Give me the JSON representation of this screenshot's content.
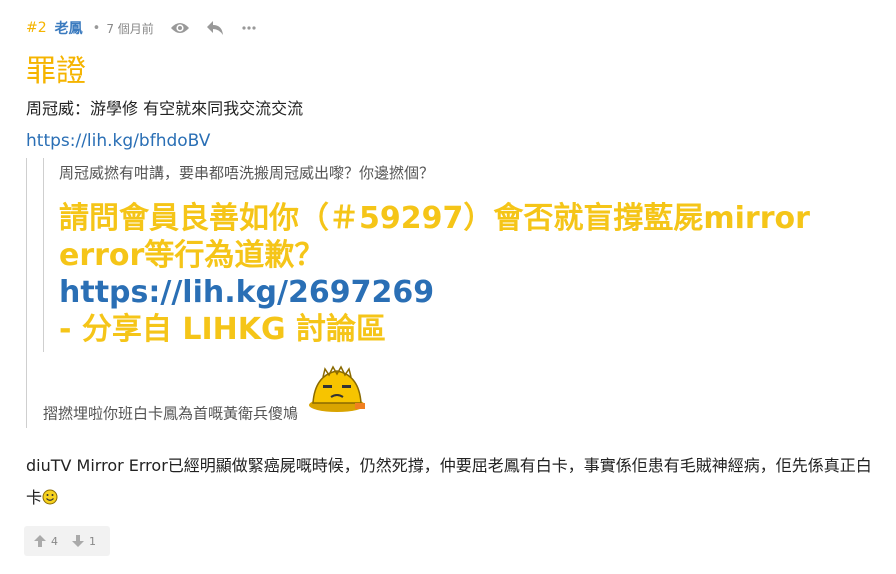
{
  "post": {
    "floor": "#2",
    "username": "老鳳",
    "separator": "•",
    "time_ago": "7 個月前",
    "icons": {
      "view": "eye-icon",
      "reply": "reply-icon",
      "more": "more-icon"
    },
    "title": "罪證",
    "line1": "周冠威：游學修 有空就來同我交流交流",
    "link1": "https://lih.kg/bfhdoBV",
    "inner_quote_text": "周冠威撚有咁講，要串都唔洗搬周冠威出嚟？你邊撚個？",
    "big_line1": "請問會員良善如你（＃59297）會否就盲撐藍屍mirror",
    "big_line2": "error等行為道歉？",
    "big_link": "https://lih.kg/2697269",
    "big_line4": "- 分享自 LIHKG 討論區",
    "quote_bottom": "摺撚埋啦你班白卡鳳為首嘅黃衛兵傻鳩",
    "body_text": "diuTV Mirror Error已經明顯做緊癌屍嘅時候，仍然死撐，仲要屈老鳳有白卡，事實係佢患有毛賊神經病，佢先係真正白卡",
    "upvotes": "4",
    "downvotes": "1"
  },
  "colors": {
    "accent_yellow": "#f5b400",
    "username_blue": "#3b7bbf",
    "link_blue": "#2a6fb5"
  }
}
